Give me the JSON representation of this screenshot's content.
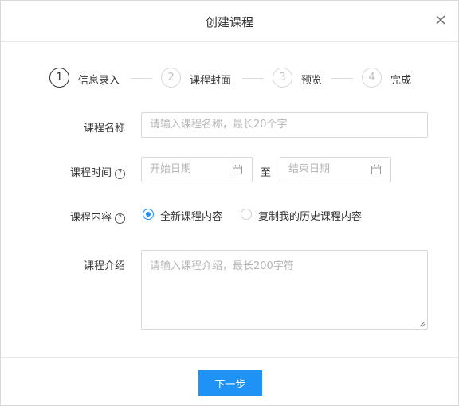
{
  "dialog": {
    "title": "创建课程"
  },
  "steps": [
    {
      "number": "1",
      "label": "信息录入"
    },
    {
      "number": "2",
      "label": "课程封面"
    },
    {
      "number": "3",
      "label": "预览"
    },
    {
      "number": "4",
      "label": "完成"
    }
  ],
  "form": {
    "course_name": {
      "label": "课程名称",
      "placeholder": "请输入课程名称，最长20个字"
    },
    "course_time": {
      "label": "课程时间",
      "start_placeholder": "开始日期",
      "separator": "至",
      "end_placeholder": "结束日期"
    },
    "course_content": {
      "label": "课程内容",
      "options": [
        "全新课程内容",
        "复制我的历史课程内容"
      ],
      "selected": "全新课程内容"
    },
    "course_intro": {
      "label": "课程介绍",
      "placeholder": "请输入课程介绍，最长200字符"
    }
  },
  "footer": {
    "next_label": "下一步"
  },
  "colors": {
    "accent": "#1e93f5",
    "radio_checked": "#1890ff"
  },
  "icons": [
    "close-icon",
    "calendar-icon",
    "help-icon",
    "resize-grip-icon"
  ]
}
